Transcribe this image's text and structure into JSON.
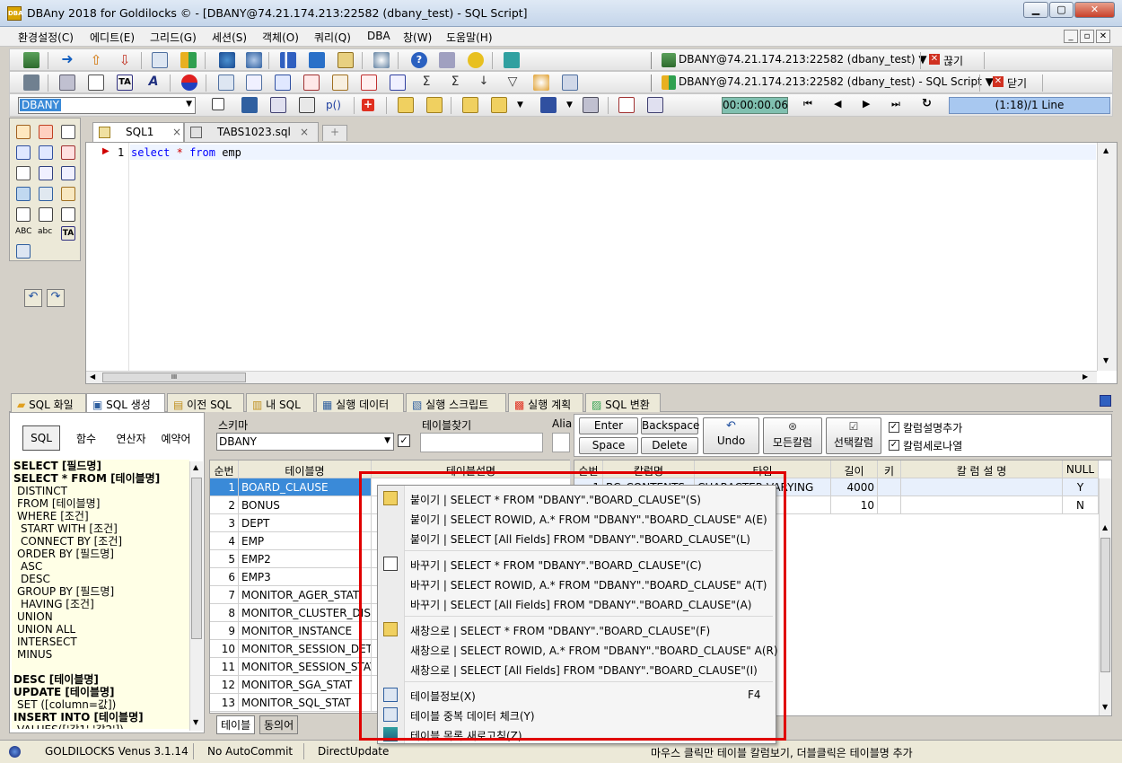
{
  "window": {
    "title": "DBAny 2018 for Goldilocks © - [DBANY@74.21.174.213:22582 (dbany_test) - SQL Script]",
    "min": "▁",
    "max": "▢",
    "close": "✕",
    "app_icon_text": "DBA"
  },
  "menu": [
    "환경설정(C)",
    "에디트(E)",
    "그리드(G)",
    "세션(S)",
    "객체(O)",
    "쿼리(Q)",
    "DBA",
    "창(W)",
    "도움말(H)"
  ],
  "mdi": [
    "_",
    "▫",
    "✕"
  ],
  "connections": {
    "session": "DBANY@74.21.174.213:22582 (dbany_test) ▼",
    "disconnect": "끊기",
    "script": "DBANY@74.21.174.213:22582 (dbany_test) - SQL Script ▼",
    "close": "닫기"
  },
  "toolbar3": {
    "schema": "DBANY",
    "timer": "00:00:00.06",
    "position": "(1:18)/1 Line",
    "p_label": "p()"
  },
  "editor": {
    "tabs": [
      {
        "label": "SQL1"
      },
      {
        "label": "TABS1023.sql"
      }
    ],
    "line_no": "1",
    "code": {
      "kw1": "select",
      "op": "*",
      "kw2": "from",
      "ident": "emp"
    },
    "hscroll_mark": "III"
  },
  "bottom_tabs": [
    "SQL 화일",
    "SQL 생성",
    "이전 SQL",
    "내 SQL",
    "실행 데이터",
    "실행 스크립트",
    "실행 계획",
    "SQL 변환"
  ],
  "sqlgen": {
    "segments": [
      "SQL",
      "함수",
      "연산자",
      "예약어"
    ],
    "items": [
      {
        "t": "SELECT [필드명]",
        "b": true,
        "i": 0
      },
      {
        "t": "SELECT * FROM [테이블명]",
        "b": true,
        "i": 0
      },
      {
        "t": "DISTINCT",
        "b": false,
        "i": 1
      },
      {
        "t": "FROM [테이블명]",
        "b": false,
        "i": 1
      },
      {
        "t": "WHERE [조건]",
        "b": false,
        "i": 1
      },
      {
        "t": "START WITH [조건]",
        "b": false,
        "i": 2
      },
      {
        "t": "CONNECT BY [조건]",
        "b": false,
        "i": 2
      },
      {
        "t": "ORDER BY [필드명]",
        "b": false,
        "i": 1
      },
      {
        "t": "ASC",
        "b": false,
        "i": 2
      },
      {
        "t": "DESC",
        "b": false,
        "i": 2
      },
      {
        "t": "GROUP BY [필드명]",
        "b": false,
        "i": 1
      },
      {
        "t": "HAVING [조건]",
        "b": false,
        "i": 2
      },
      {
        "t": "UNION",
        "b": false,
        "i": 1
      },
      {
        "t": "UNION ALL",
        "b": false,
        "i": 1
      },
      {
        "t": "INTERSECT",
        "b": false,
        "i": 1
      },
      {
        "t": "MINUS",
        "b": false,
        "i": 1
      },
      {
        "t": "",
        "b": false,
        "i": 0
      },
      {
        "t": "DESC [테이블명]",
        "b": true,
        "i": 0
      },
      {
        "t": "UPDATE [테이블명]",
        "b": true,
        "i": 0
      },
      {
        "t": "SET ([column=값])",
        "b": false,
        "i": 1
      },
      {
        "t": "INSERT INTO [테이블명]",
        "b": true,
        "i": 0
      },
      {
        "t": "VALUES(['값1','값2'])",
        "b": false,
        "i": 1
      }
    ]
  },
  "tables": {
    "schema_label": "스키마",
    "schema": "DBANY",
    "find_label": "테이블찾기",
    "alias_label": "Alia",
    "headers": [
      "순번",
      "테이블명",
      "테이블설명"
    ],
    "rows": [
      [
        "1",
        "BOARD_CLAUSE"
      ],
      [
        "2",
        "BONUS"
      ],
      [
        "3",
        "DEPT"
      ],
      [
        "4",
        "EMP"
      ],
      [
        "5",
        "EMP2"
      ],
      [
        "6",
        "EMP3"
      ],
      [
        "7",
        "MONITOR_AGER_STAT"
      ],
      [
        "8",
        "MONITOR_CLUSTER_DISPA"
      ],
      [
        "9",
        "MONITOR_INSTANCE"
      ],
      [
        "10",
        "MONITOR_SESSION_DETAI"
      ],
      [
        "11",
        "MONITOR_SESSION_STAT"
      ],
      [
        "12",
        "MONITOR_SGA_STAT"
      ],
      [
        "13",
        "MONITOR_SQL_STAT"
      ]
    ],
    "bottom_tabs": [
      "테이블",
      "동의어"
    ]
  },
  "columns": {
    "buttons": {
      "enter": "Enter",
      "backspace": "Backspace",
      "space": "Space",
      "delete": "Delete",
      "undo": "Undo",
      "all": "모든칼럼",
      "selected": "선택칼럼"
    },
    "checks": [
      "칼럼설명추가",
      "칼럼세로나열"
    ],
    "headers": [
      "순번",
      "칼럼명",
      "타입",
      "길이",
      "키",
      "칼 럼 설 명",
      "NULL"
    ],
    "rows": [
      [
        "1",
        "BC_CONTENTS",
        "CHARACTER VARYING",
        "4000",
        "",
        "",
        "Y"
      ],
      [
        "2",
        "",
        "",
        "10",
        "",
        "",
        "N"
      ]
    ]
  },
  "status": {
    "db": "GOLDILOCKS Venus 3.1.14",
    "commit": "No AutoCommit",
    "update": "DirectUpdate",
    "hint": "마우스 클릭만 테이블 칼럼보기, 더블클릭은 테이블명 추가"
  },
  "context_menu": {
    "items": [
      "붙이기 | SELECT * FROM \"DBANY\".\"BOARD_CLAUSE\"(S)",
      "붙이기 | SELECT ROWID, A.* FROM \"DBANY\".\"BOARD_CLAUSE\" A(E)",
      "붙이기 | SELECT [All Fields] FROM \"DBANY\".\"BOARD_CLAUSE\"(L)",
      "바꾸기 | SELECT * FROM \"DBANY\".\"BOARD_CLAUSE\"(C)",
      "바꾸기 | SELECT ROWID, A.* FROM \"DBANY\".\"BOARD_CLAUSE\" A(T)",
      "바꾸기 | SELECT [All Fields] FROM \"DBANY\".\"BOARD_CLAUSE\"(A)",
      "새창으로 | SELECT * FROM \"DBANY\".\"BOARD_CLAUSE\"(F)",
      "새창으로 | SELECT ROWID, A.* FROM \"DBANY\".\"BOARD_CLAUSE\" A(R)",
      "새창으로 | SELECT [All Fields] FROM \"DBANY\".\"BOARD_CLAUSE\"(I)",
      "테이블정보(X)",
      "테이블 중복 데이터 체크(Y)",
      "테이블 목록 새로고침(Z)"
    ],
    "shortcut": "F4"
  },
  "colors": {
    "accent": "#e00000",
    "selection": "#3a8ad8",
    "keyword": "#0000ff"
  }
}
